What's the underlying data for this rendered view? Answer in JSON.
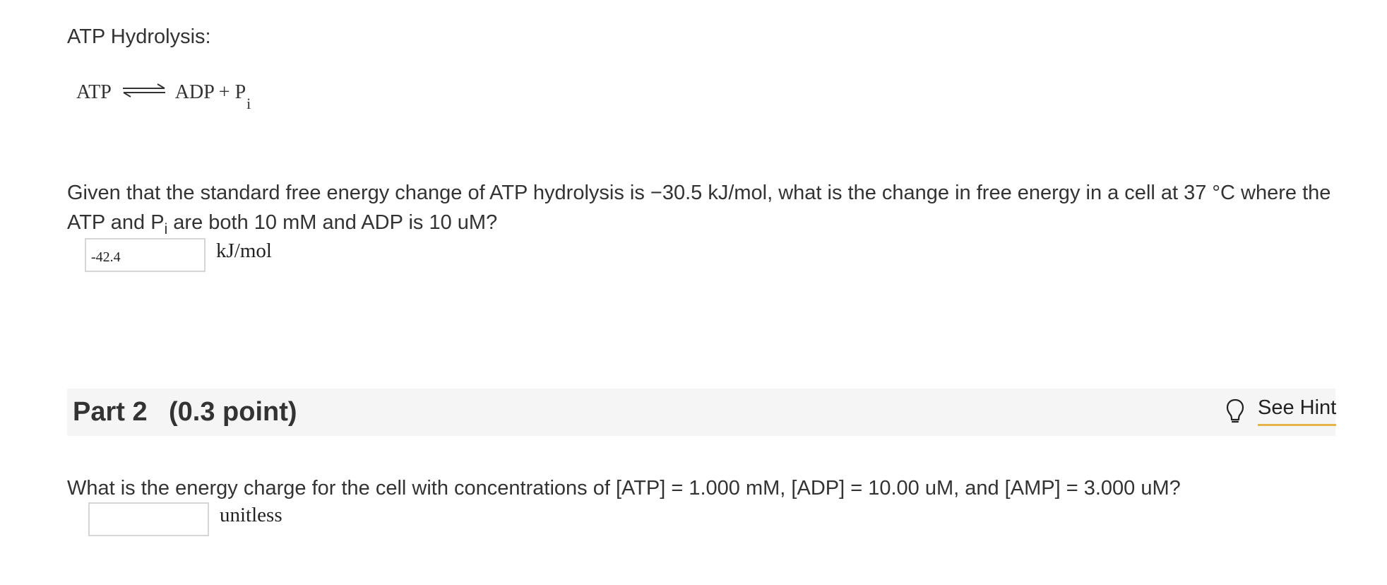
{
  "intro": {
    "title": "ATP Hydrolysis:"
  },
  "reaction": {
    "reactant": "ATP",
    "products": "ADP + P",
    "products_subscript": "i",
    "arrow_icon": "equilibrium-arrow-icon"
  },
  "part1": {
    "question_line1": "Given that the standard free energy change of ATP hydrolysis is −30.5 kJ/mol, what is the change in free energy in a cell at 37 °C where the",
    "question_line2_pre": "ATP and P",
    "question_line2_sub": "i",
    "question_line2_post": " are both 10 mM and ADP is 10 uM?",
    "answer_value": "-42.4",
    "unit": "kJ/mol"
  },
  "part2": {
    "label": "Part 2",
    "points": "(0.3 point)",
    "hint_label": "See Hint",
    "hint_icon": "lightbulb-icon",
    "question": "What is the energy charge for the cell with concentrations of [ATP] = 1.000 mM, [ADP] = 10.00 uM, and [AMP] = 3.000 uM?",
    "answer_value": "",
    "unit": "unitless"
  },
  "colors": {
    "text": "#333333",
    "part_bar_bg": "#f5f5f5",
    "input_border": "#d6d6d6",
    "hint_underline": "#e5b54a"
  }
}
